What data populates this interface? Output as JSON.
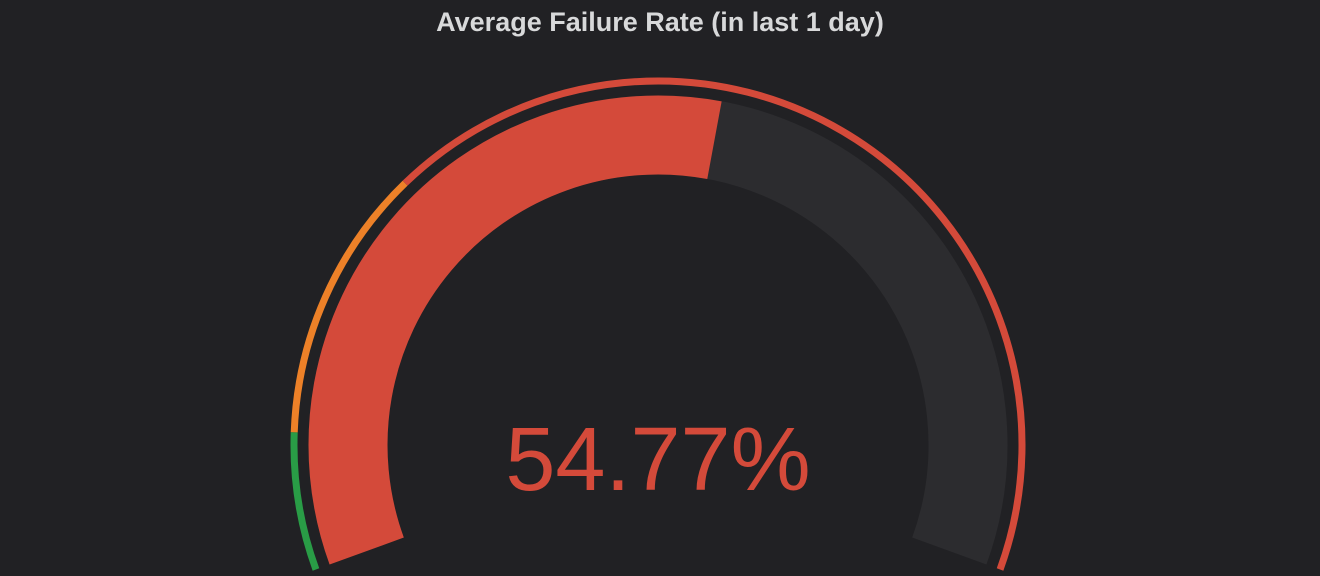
{
  "panel": {
    "title": "Average Failure Rate (in last 1 day)"
  },
  "gauge": {
    "value": 54.77,
    "display_value": "54.77%",
    "min": 0,
    "max": 100,
    "unit": "%",
    "value_color": "#d44a3a",
    "track_color": "#2c2c2f",
    "thresholds": [
      {
        "from": 0,
        "to": 10,
        "color": "#299c46"
      },
      {
        "from": 10,
        "to": 30,
        "color": "#ed8128"
      },
      {
        "from": 30,
        "to": 100,
        "color": "#d44a3a"
      }
    ]
  }
}
